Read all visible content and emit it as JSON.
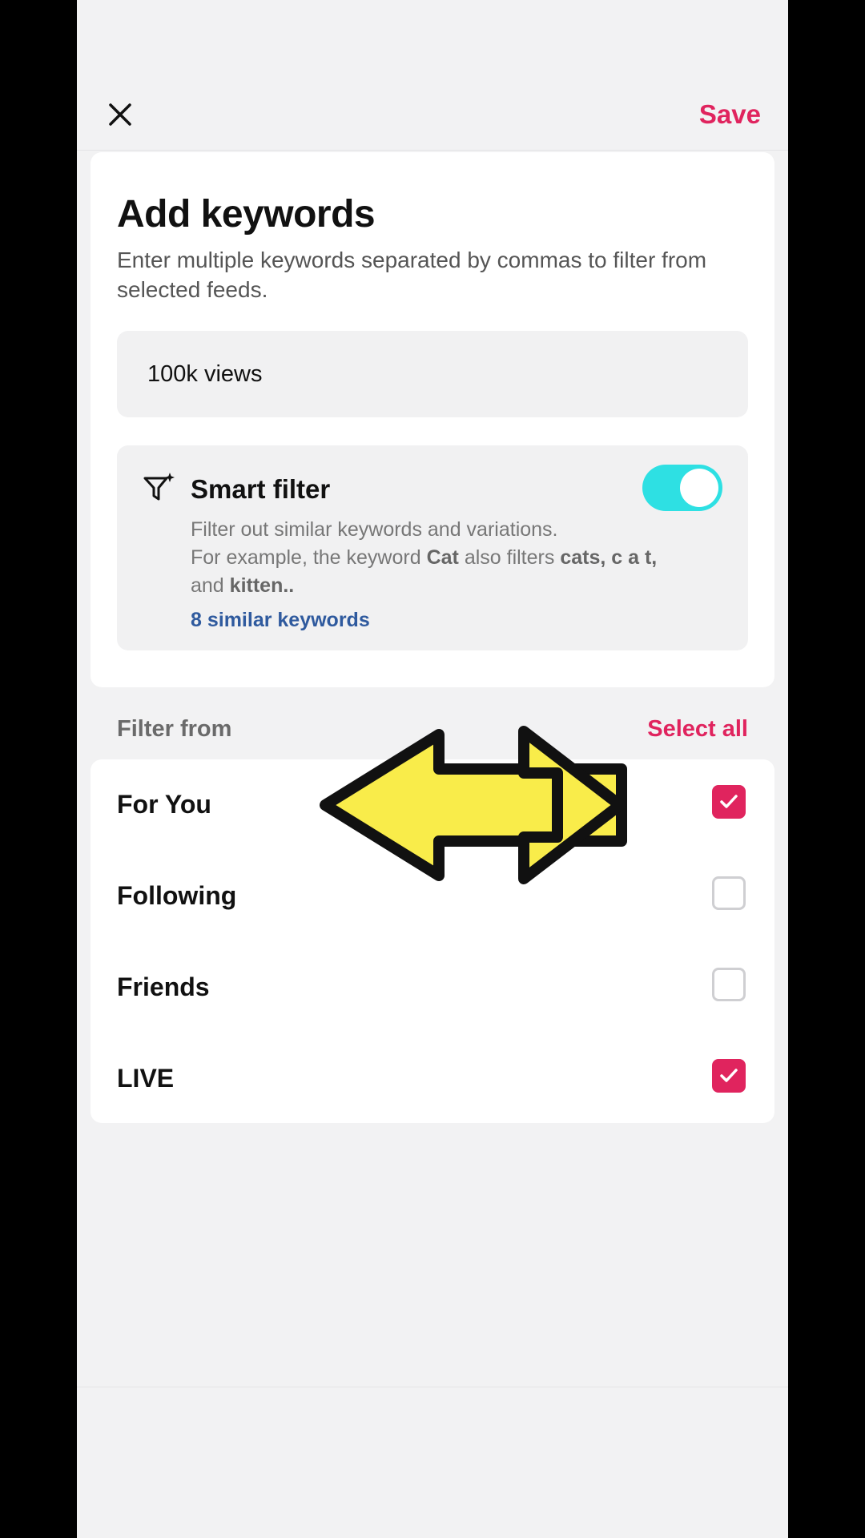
{
  "header": {
    "close_icon": "close-icon",
    "save_label": "Save"
  },
  "keywords": {
    "title": "Add keywords",
    "subtitle": "Enter multiple keywords separated by commas to filter from selected feeds.",
    "input_value": "100k views"
  },
  "smart_filter": {
    "icon": "smart-filter-icon",
    "title": "Smart filter",
    "enabled": true,
    "desc_line1": "Filter out similar keywords and variations.",
    "desc_prefix": "For example, the keyword ",
    "desc_keyword": "Cat",
    "desc_mid": " also filters ",
    "desc_variants": "cats, c a t,",
    "desc_and": " and ",
    "desc_last": "kitten..",
    "similar_link": "8 similar keywords"
  },
  "filter_from": {
    "label": "Filter from",
    "select_all": "Select all",
    "items": [
      {
        "label": "For You",
        "checked": true
      },
      {
        "label": "Following",
        "checked": false
      },
      {
        "label": "Friends",
        "checked": false
      },
      {
        "label": "LIVE",
        "checked": true
      }
    ]
  },
  "colors": {
    "accent": "#e0245e",
    "toggle_on": "#2ee0e3",
    "link": "#2f5a9e",
    "annotation_arrow": "#f9ec4a"
  }
}
